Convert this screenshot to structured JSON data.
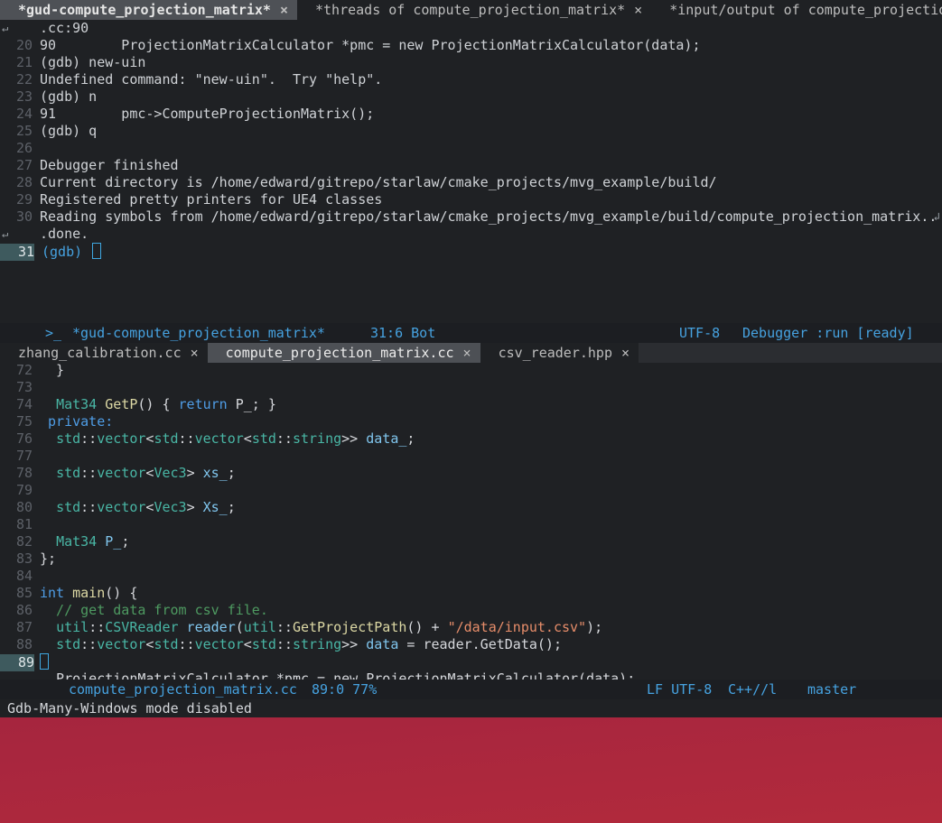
{
  "top_tabs": [
    {
      "label": "*gud-compute_projection_matrix*",
      "close": "×",
      "active": true
    },
    {
      "label": "*threads of compute_projection_matrix*",
      "close": "×",
      "active": false
    },
    {
      "label": "*input/output of compute_projectio",
      "close": "",
      "active": false
    }
  ],
  "gud": {
    "lines": [
      {
        "n": "",
        "text": ".cc:90"
      },
      {
        "n": "20",
        "text": "90        ProjectionMatrixCalculator *pmc = new ProjectionMatrixCalculator(data);"
      },
      {
        "n": "21",
        "text": "(gdb) new-uin"
      },
      {
        "n": "22",
        "text": "Undefined command: \"new-uin\".  Try \"help\"."
      },
      {
        "n": "23",
        "text": "(gdb) n"
      },
      {
        "n": "24",
        "text": "91        pmc->ComputeProjectionMatrix();"
      },
      {
        "n": "25",
        "text": "(gdb) q"
      },
      {
        "n": "26",
        "text": ""
      },
      {
        "n": "27",
        "text": "Debugger finished"
      },
      {
        "n": "28",
        "text": "Current directory is /home/edward/gitrepo/starlaw/cmake_projects/mvg_example/build/"
      },
      {
        "n": "29",
        "text": "Registered pretty printers for UE4 classes"
      },
      {
        "n": "30",
        "text": "Reading symbols from /home/edward/gitrepo/starlaw/cmake_projects/mvg_example/build/compute_projection_matrix.."
      },
      {
        "n": "",
        "text": ".done."
      },
      {
        "n": "31",
        "text": "(gdb) "
      }
    ]
  },
  "gud_modeline": {
    "prompt_icon": ">_",
    "buffer": "*gud-compute_projection_matrix*",
    "position": "31:6 Bot",
    "encoding": "UTF-8",
    "mode": "Debugger :run [ready]"
  },
  "bottom_tabs": [
    {
      "label": "zhang_calibration.cc",
      "close": "×",
      "active": false
    },
    {
      "label": "compute_projection_matrix.cc",
      "close": "×",
      "active": true
    },
    {
      "label": "csv_reader.hpp",
      "close": "×",
      "active": false
    }
  ],
  "code_lines": [
    {
      "n": "72"
    },
    {
      "n": "73"
    },
    {
      "n": "74"
    },
    {
      "n": "75"
    },
    {
      "n": "76"
    },
    {
      "n": "77"
    },
    {
      "n": "78"
    },
    {
      "n": "79"
    },
    {
      "n": "80"
    },
    {
      "n": "81"
    },
    {
      "n": "82"
    },
    {
      "n": "83"
    },
    {
      "n": "84"
    },
    {
      "n": "85"
    },
    {
      "n": "86"
    },
    {
      "n": "87"
    },
    {
      "n": "88"
    },
    {
      "n": "89"
    }
  ],
  "code": {
    "l72": "  }",
    "l74": {
      "a": "  ",
      "type": "Mat34",
      "fn": " GetP",
      "b": "() { ",
      "kw": "return",
      "c": " P_; }"
    },
    "l75": " private:",
    "l76": {
      "a": "  ",
      "ns1": "std",
      "sep": "::",
      "t1": "vector",
      "lt": "<",
      "ns2": "std",
      "t2": "vector",
      "ns3": "std",
      "t3": "string",
      "end": ">> ",
      "var": "data_",
      "semi": ";"
    },
    "l78": {
      "a": "  ",
      "ns": "std",
      "sep": "::",
      "t": "vector",
      "lt": "<",
      "inner": "Vec3",
      "gt": "> ",
      "var": "xs_",
      "semi": ";"
    },
    "l80": {
      "a": "  ",
      "ns": "std",
      "sep": "::",
      "t": "vector",
      "lt": "<",
      "inner": "Vec3",
      "gt": "> ",
      "var": "Xs_",
      "semi": ";"
    },
    "l82": {
      "a": "  ",
      "type": "Mat34",
      "var": " P_",
      "semi": ";"
    },
    "l83": "};",
    "l85": {
      "kw": "int",
      "fn": " main",
      "rest": "() {"
    },
    "l86": "  // get data from csv file.",
    "l87": {
      "a": "  ",
      "ns1": "util",
      "sep": "::",
      "t": "CSVReader",
      "var": " reader",
      "p1": "(",
      "ns2": "util",
      "fn": "GetProjectPath",
      "p2": "() + ",
      "str": "\"/data/input.csv\"",
      "p3": ");"
    },
    "l88": {
      "a": "  ",
      "ns1": "std",
      "sep": "::",
      "t1": "vector",
      "lt": "<",
      "ns2": "std",
      "t2": "vector",
      "ns3": "std",
      "t3": "string",
      "end": ">> ",
      "var": "data",
      "rest": " = reader.GetData();"
    },
    "l90_partial": "  ProjectionMatrixCalculator *pmc = new ProjectionMatrixCalculator(data);"
  },
  "code_modeline": {
    "file": "compute_projection_matrix.cc",
    "position": "89:0 77%",
    "eol_enc": "LF UTF-8",
    "mode": "C++//l",
    "branch": "master"
  },
  "echo_area": "Gdb-Many-Windows mode disabled",
  "colors": {
    "accent": "#46a2e0",
    "background": "#1f2124"
  }
}
